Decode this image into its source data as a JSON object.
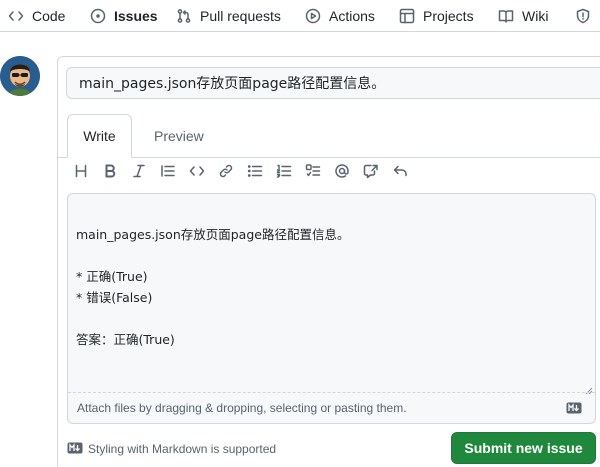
{
  "nav": {
    "code": "Code",
    "issues": "Issues",
    "pulls": "Pull requests",
    "actions": "Actions",
    "projects": "Projects",
    "wiki": "Wiki"
  },
  "issue": {
    "title_value": "main_pages.json存放页面page路径配置信息。",
    "tab_write": "Write",
    "tab_preview": "Preview",
    "body": "main_pages.json存放页面page路径配置信息。\n\n* 正确(True)\n* 错误(False)\n\n答案：正确(True)",
    "attach_hint": "Attach files by dragging & dropping, selecting or pasting them.",
    "markdown_note": "Styling with Markdown is supported",
    "submit_label": "Submit new issue"
  },
  "colors": {
    "accent_underline": "#fd8c73",
    "submit_bg": "#1f883d"
  }
}
